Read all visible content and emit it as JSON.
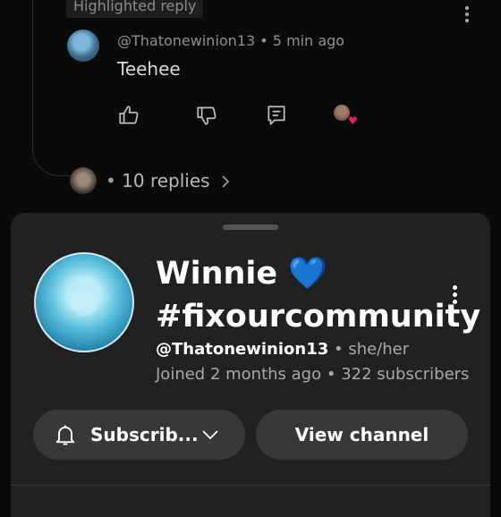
{
  "comment": {
    "highlight_label": "Highlighted reply",
    "reply_author": "@Thatonewinion13",
    "reply_time": "5 min ago",
    "reply_text": "Teehee",
    "replies_count_label": "10 replies"
  },
  "channel": {
    "name": "Winnie 💙 #fixourcommunity",
    "handle": "@Thatonewinion13",
    "pronouns": "she/her",
    "joined": "Joined 2 months ago",
    "subscribers": "322 subscribers",
    "subscribe_label": "Subscrib...",
    "view_channel_label": "View channel"
  },
  "icons": [
    "kebab-icon",
    "like-icon",
    "dislike-icon",
    "reply-icon",
    "heart-icon",
    "chevron-right-icon",
    "bell-icon",
    "chevron-down-icon"
  ],
  "colors": {
    "background": "#0a0a0a",
    "sheet": "#212121",
    "button": "#383838",
    "heart": "#e0245e"
  }
}
